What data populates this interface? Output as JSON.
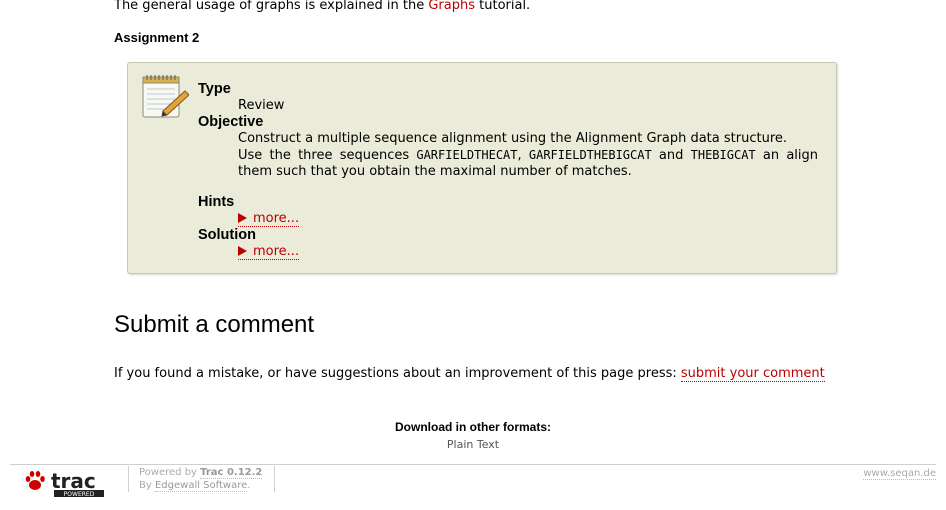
{
  "intro": {
    "before": "The general usage of graphs is explained in the ",
    "link": "Graphs",
    "after": " tutorial."
  },
  "assignment": {
    "heading": "Assignment 2",
    "type_term": "Type",
    "type_value": "Review",
    "objective_term": "Objective",
    "objective_line1": "Construct a multiple sequence alignment using the Alignment Graph data structure.",
    "objective_p1": "Use the three sequences ",
    "seq1": "GARFIELDTHECAT",
    "sep1": ", ",
    "seq2": "GARFIELDTHEBIGCAT",
    "sep2": " and ",
    "seq3": "THEBIGCAT",
    "objective_p2": " an align them such that you obtain the maximal number of matches.",
    "hints_term": "Hints",
    "hints_more": "more...",
    "solution_term": "Solution",
    "solution_more": "more..."
  },
  "comment": {
    "heading": "Submit a comment",
    "text": "If you found a mistake, or have suggestions about an improvement of this page press: ",
    "link": "submit your comment"
  },
  "download": {
    "label": "Download in other formats:",
    "item": "Plain Text"
  },
  "footer": {
    "logo_text": "trac",
    "logo_sub": "POWERED",
    "powered_by": "Powered by ",
    "trac_version": "Trac 0.12.2",
    "by": "By ",
    "edgewall": "Edgewall Software",
    "period": ".",
    "site": "www.seqan.de"
  },
  "colors": {
    "link": "#bb0000",
    "box_bg": "#ebebd9"
  },
  "icons": [
    "notepad-pencil-icon",
    "disclosure-triangle-icon",
    "trac-paw-logo"
  ]
}
